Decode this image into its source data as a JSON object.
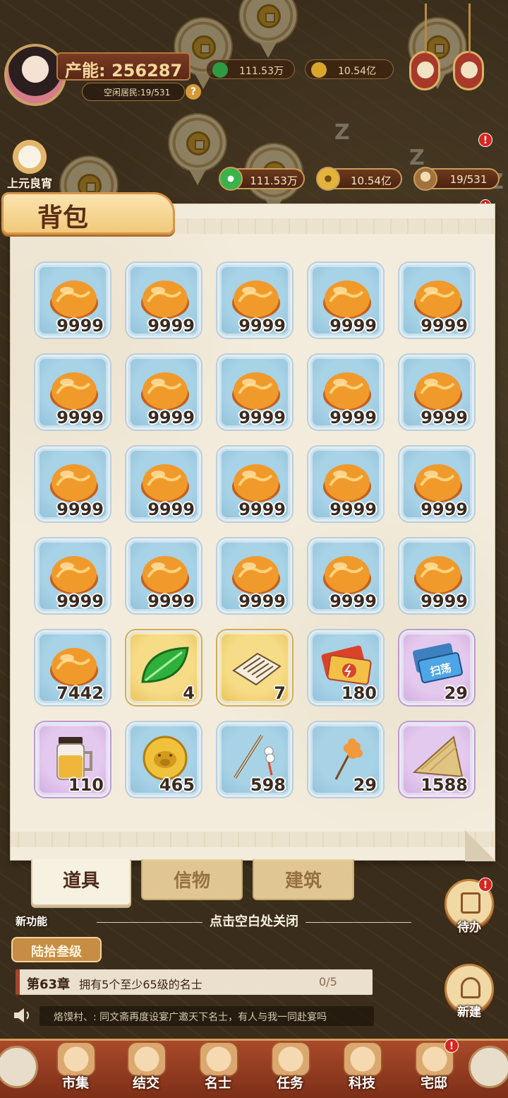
{
  "hud": {
    "production_label": "产能:",
    "production_value": "256287",
    "idle_residents": "空闲居民:19/531",
    "qmark": "?",
    "ghost_jade": "111.53万",
    "ghost_coin": "10.54亿",
    "festival_label": "上元良宵"
  },
  "resources": {
    "jade": "111.53万",
    "coins": "10.54亿",
    "residents": "19/531"
  },
  "bag": {
    "title": "背包",
    "items": [
      {
        "icon": "amber-stone-icon",
        "qty": "9999",
        "bg": "blue"
      },
      {
        "icon": "amber-stone-icon",
        "qty": "9999",
        "bg": "blue"
      },
      {
        "icon": "amber-stone-icon",
        "qty": "9999",
        "bg": "blue"
      },
      {
        "icon": "amber-stone-icon",
        "qty": "9999",
        "bg": "blue"
      },
      {
        "icon": "amber-stone-icon",
        "qty": "9999",
        "bg": "blue"
      },
      {
        "icon": "amber-stone-icon",
        "qty": "9999",
        "bg": "blue"
      },
      {
        "icon": "amber-stone-icon",
        "qty": "9999",
        "bg": "blue"
      },
      {
        "icon": "amber-stone-icon",
        "qty": "9999",
        "bg": "blue"
      },
      {
        "icon": "amber-stone-icon",
        "qty": "9999",
        "bg": "blue"
      },
      {
        "icon": "amber-stone-icon",
        "qty": "9999",
        "bg": "blue"
      },
      {
        "icon": "amber-stone-icon",
        "qty": "9999",
        "bg": "blue"
      },
      {
        "icon": "amber-stone-icon",
        "qty": "9999",
        "bg": "blue"
      },
      {
        "icon": "amber-stone-icon",
        "qty": "9999",
        "bg": "blue"
      },
      {
        "icon": "amber-stone-icon",
        "qty": "9999",
        "bg": "blue"
      },
      {
        "icon": "amber-stone-icon",
        "qty": "9999",
        "bg": "blue"
      },
      {
        "icon": "amber-stone-icon",
        "qty": "9999",
        "bg": "blue"
      },
      {
        "icon": "amber-stone-icon",
        "qty": "9999",
        "bg": "blue"
      },
      {
        "icon": "amber-stone-icon",
        "qty": "9999",
        "bg": "blue"
      },
      {
        "icon": "amber-stone-icon",
        "qty": "9999",
        "bg": "blue"
      },
      {
        "icon": "amber-stone-icon",
        "qty": "9999",
        "bg": "blue"
      },
      {
        "icon": "amber-stone-icon",
        "qty": "7442",
        "bg": "blue"
      },
      {
        "icon": "green-leaf-icon",
        "qty": "4",
        "bg": "gold"
      },
      {
        "icon": "scroll-book-icon",
        "qty": "7",
        "bg": "gold"
      },
      {
        "icon": "energy-ticket-icon",
        "qty": "180",
        "bg": "blue"
      },
      {
        "icon": "sweep-ticket-icon",
        "qty": "29",
        "bg": "purple",
        "ticket_text": "扫荡"
      },
      {
        "icon": "tea-jar-icon",
        "qty": "110",
        "bg": "purple"
      },
      {
        "icon": "pig-coin-icon",
        "qty": "465",
        "bg": "blue"
      },
      {
        "icon": "fishing-rod-icon",
        "qty": "598",
        "bg": "blue"
      },
      {
        "icon": "candy-stick-icon",
        "qty": "29",
        "bg": "blue"
      },
      {
        "icon": "zongzi-icon",
        "qty": "1588",
        "bg": "purple"
      }
    ]
  },
  "tabs": {
    "items": "道具",
    "tokens": "信物",
    "buildings": "建筑"
  },
  "close_hint": "点击空白处关闭",
  "lower_hud": {
    "new_feature": "新功能",
    "level": "陆拾叁级",
    "chapter": "第63章",
    "chapter_task": "拥有5个至少65级的名士",
    "chapter_progress": "0/5",
    "broadcast": "烙馍村、: 同文斋再度设宴广邀天下名士，有人与我一同赴宴吗",
    "todo": "待办",
    "new_build": "新建"
  },
  "nav": {
    "market": "市集",
    "socialize": "结交",
    "celebrities": "名士",
    "tasks": "任务",
    "tech": "科技",
    "mansion": "宅邸"
  },
  "badge": "!",
  "colors": {
    "slot_blue": "#9ccbe0",
    "slot_gold": "#f0cd6c",
    "slot_purple": "#dbbbe8",
    "panel": "#f3ecdc",
    "title_text": "#5b2e16",
    "nav_bg": "#9a3f22"
  }
}
